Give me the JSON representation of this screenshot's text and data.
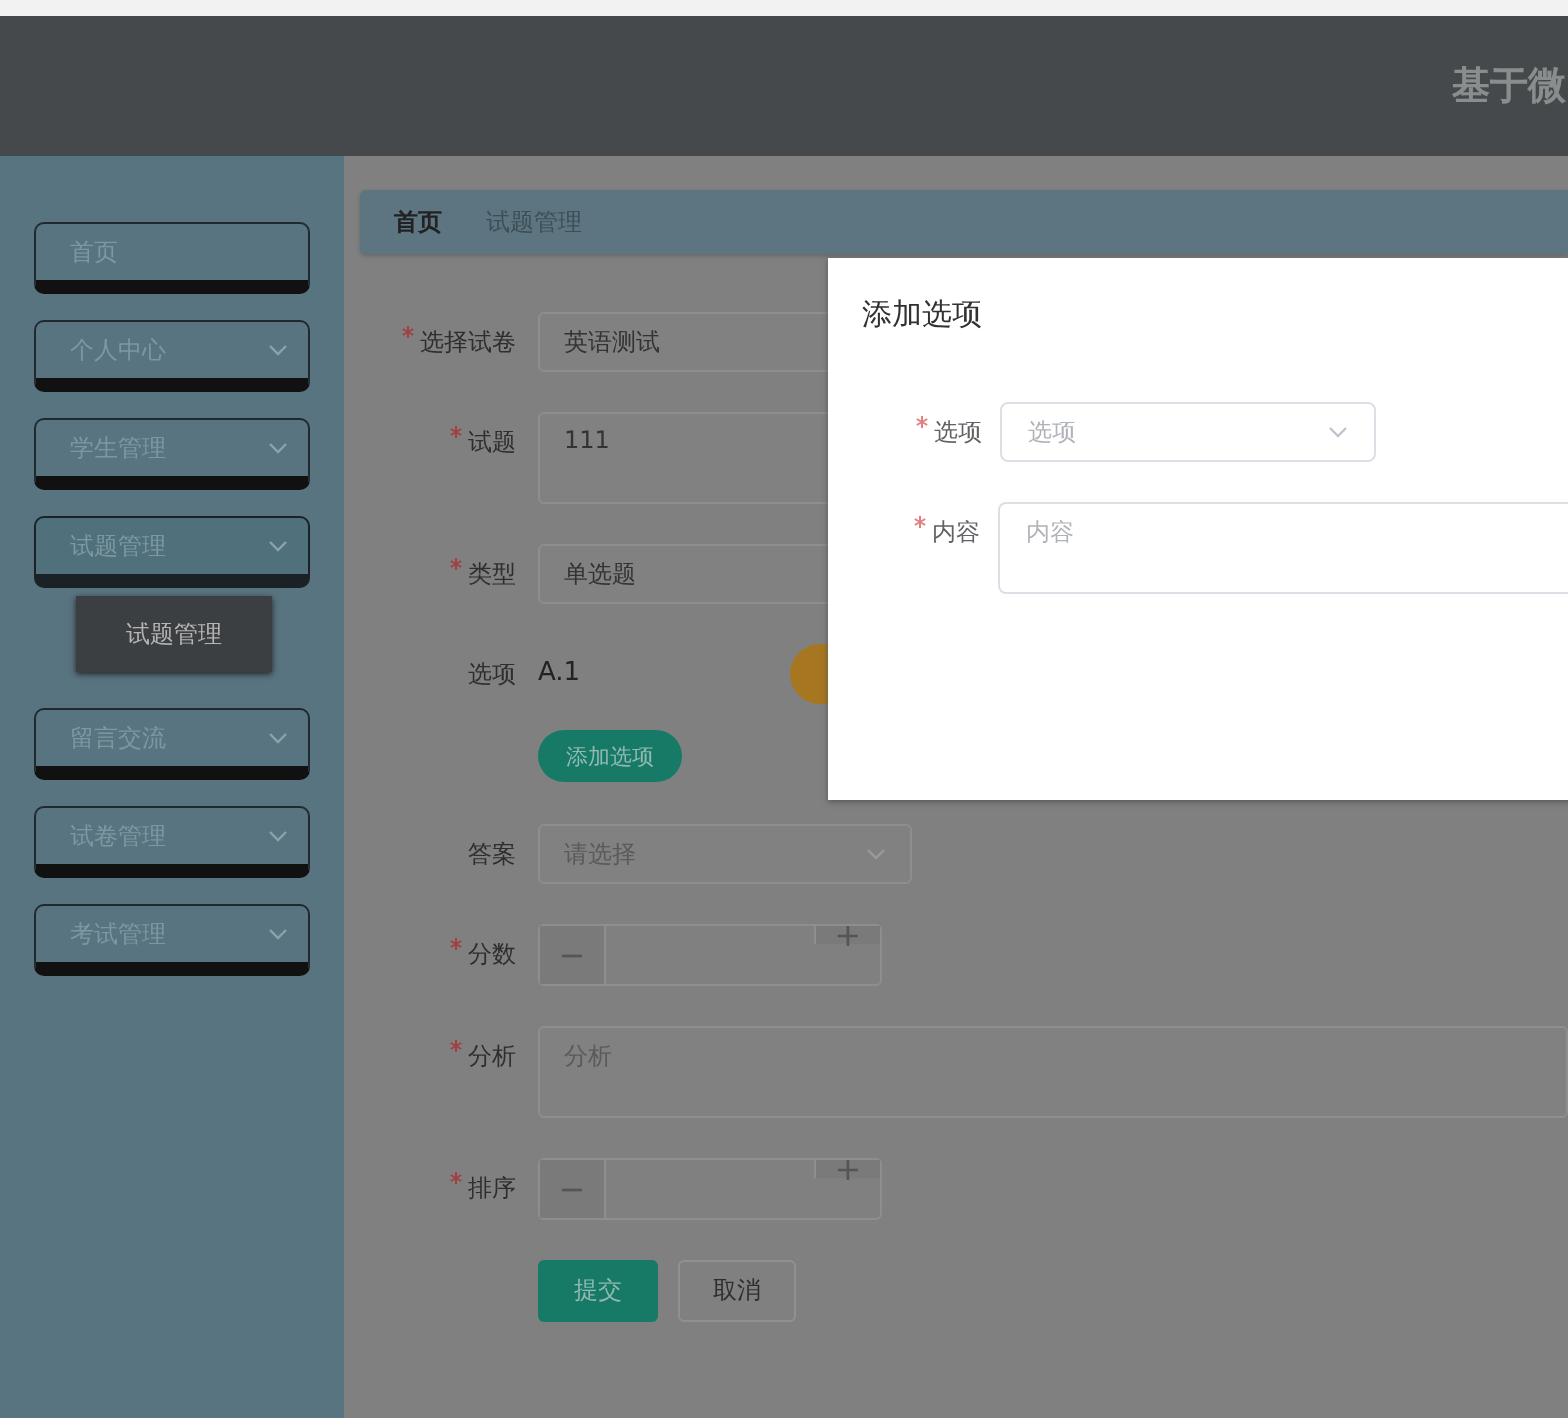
{
  "header": {
    "title": "基于微"
  },
  "sidebar": {
    "items": [
      {
        "label": "首页",
        "expandable": false,
        "expanded": false
      },
      {
        "label": "个人中心",
        "expandable": true,
        "expanded": false
      },
      {
        "label": "学生管理",
        "expandable": true,
        "expanded": false
      },
      {
        "label": "试题管理",
        "expandable": true,
        "expanded": true,
        "children": [
          {
            "label": "试题管理"
          }
        ]
      },
      {
        "label": "留言交流",
        "expandable": true,
        "expanded": false
      },
      {
        "label": "试卷管理",
        "expandable": true,
        "expanded": false
      },
      {
        "label": "考试管理",
        "expandable": true,
        "expanded": false
      }
    ]
  },
  "breadcrumb": [
    {
      "label": "首页",
      "selected": false
    },
    {
      "label": "试题管理",
      "selected": true
    }
  ],
  "form": {
    "fields": [
      {
        "kind": "select",
        "label": "选择试卷",
        "required": true,
        "value": "英语测试",
        "short": false
      },
      {
        "kind": "textarea",
        "label": "试题",
        "required": true,
        "value": "111"
      },
      {
        "kind": "select",
        "label": "类型",
        "required": true,
        "value": "单选题",
        "short": false
      },
      {
        "kind": "options",
        "label": "选项",
        "required": false,
        "value": "A.1"
      },
      {
        "kind": "button",
        "label": "添加选项"
      },
      {
        "kind": "select",
        "label": "答案",
        "required": false,
        "placeholder": "请选择",
        "short": true
      },
      {
        "kind": "number",
        "label": "分数",
        "required": true,
        "minus": "−",
        "plus": "+"
      },
      {
        "kind": "textarea",
        "label": "分析",
        "required": true,
        "placeholder": "分析"
      },
      {
        "kind": "number",
        "label": "排序",
        "required": true,
        "minus": "−",
        "plus": "+"
      }
    ],
    "submit": "提交",
    "cancel": "取消"
  },
  "dialog": {
    "title": "添加选项",
    "fields": [
      {
        "kind": "select",
        "label": "选项",
        "required": true,
        "placeholder": "选项"
      },
      {
        "kind": "textarea",
        "label": "内容",
        "required": true,
        "placeholder": "内容"
      }
    ]
  }
}
